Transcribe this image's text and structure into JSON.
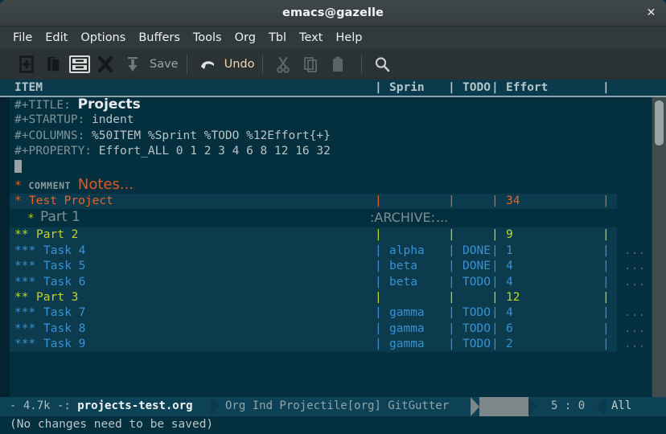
{
  "window": {
    "title": "emacs@gazelle",
    "close_label": "✕"
  },
  "menubar": {
    "items": [
      {
        "label": "File"
      },
      {
        "label": "Edit"
      },
      {
        "label": "Options"
      },
      {
        "label": "Buffers"
      },
      {
        "label": "Tools"
      },
      {
        "label": "Org"
      },
      {
        "label": "Tbl"
      },
      {
        "label": "Text"
      },
      {
        "label": "Help"
      }
    ]
  },
  "toolbar": {
    "items": [
      {
        "name": "new-file-icon",
        "label": ""
      },
      {
        "name": "open-file-icon",
        "label": ""
      },
      {
        "name": "dired-icon",
        "label": ""
      },
      {
        "name": "close-buffer-icon",
        "label": ""
      },
      {
        "name": "save-icon",
        "label": "Save"
      },
      {
        "name": "undo-icon",
        "label": "Undo"
      },
      {
        "name": "cut-icon",
        "label": ""
      },
      {
        "name": "copy-icon",
        "label": ""
      },
      {
        "name": "paste-icon",
        "label": ""
      },
      {
        "name": "search-icon",
        "label": ""
      }
    ],
    "save_label": "Save",
    "undo_label": "Undo"
  },
  "columns_header": {
    "item": "ITEM",
    "sprint": "Sprin",
    "todo": "TODO",
    "effort": "Effort",
    "raw": "ITEM                                               | Sprin | TODO | Effort       |"
  },
  "buffer": {
    "keyword_lines": [
      {
        "key": "#+TITLE:",
        "value": "Projects",
        "big": true
      },
      {
        "key": "#+STARTUP:",
        "value": "indent",
        "big": false
      },
      {
        "key": "#+COLUMNS:",
        "value": "%50ITEM %Sprint %TODO %12Effort{+}",
        "big": false
      },
      {
        "key": "#+PROPERTY:",
        "value": "Effort_ALL 0 1 2 3 4 6 8 12 16 32",
        "big": false
      }
    ],
    "comment_heading": {
      "stars": "*",
      "tag": "COMMENT",
      "title": "Notes",
      "ellipsis": "..."
    },
    "rows": [
      {
        "kind": "column-row",
        "level": 1,
        "stars": "*",
        "title": "Test Project",
        "sprint": "",
        "todo": "",
        "effort": "34",
        "ellipsis": ""
      },
      {
        "kind": "plain",
        "level": 2,
        "stars": "*",
        "title": "Part 1",
        "tag": ":ARCHIVE:",
        "ellipsis": "..."
      },
      {
        "kind": "column-row",
        "level": 2,
        "stars": "**",
        "title": "Part 2",
        "sprint": "",
        "todo": "",
        "effort": "9",
        "ellipsis": ""
      },
      {
        "kind": "column-row",
        "level": 3,
        "stars": "***",
        "title": "Task 4",
        "sprint": "alpha",
        "todo": "DONE",
        "effort": "1",
        "ellipsis": "..."
      },
      {
        "kind": "column-row",
        "level": 3,
        "stars": "***",
        "title": "Task 5",
        "sprint": "beta",
        "todo": "DONE",
        "effort": "4",
        "ellipsis": "..."
      },
      {
        "kind": "column-row",
        "level": 3,
        "stars": "***",
        "title": "Task 6",
        "sprint": "beta",
        "todo": "TODO",
        "effort": "4",
        "ellipsis": "..."
      },
      {
        "kind": "column-row",
        "level": 2,
        "stars": "**",
        "title": "Part 3",
        "sprint": "",
        "todo": "",
        "effort": "12",
        "ellipsis": ""
      },
      {
        "kind": "column-row",
        "level": 3,
        "stars": "***",
        "title": "Task 7",
        "sprint": "gamma",
        "todo": "TODO",
        "effort": "4",
        "ellipsis": "..."
      },
      {
        "kind": "column-row",
        "level": 3,
        "stars": "***",
        "title": "Task 8",
        "sprint": "gamma",
        "todo": "TODO",
        "effort": "6",
        "ellipsis": "..."
      },
      {
        "kind": "column-row",
        "level": 3,
        "stars": "***",
        "title": "Task 9",
        "sprint": "gamma",
        "todo": "TODO",
        "effort": "2",
        "ellipsis": "..."
      }
    ],
    "separators": {
      "pipe": "|"
    }
  },
  "modeline": {
    "size": "- 4.7k -:",
    "buffer_name": "projects-test.org",
    "major_mode": "Org",
    "minor_modes": "Ind Projectile[org] GitGutter",
    "modes_text": "Org Ind Projectile[org] GitGutter",
    "position": "5 : 0",
    "scroll": "All"
  },
  "echo_area": {
    "message": "(No changes need to be saved)"
  },
  "colors": {
    "frame_bg": "#042f3e",
    "column_row_bg": "#0b3b4c",
    "header_bg": "#0a3a4b",
    "modeline_bg": "#0d4155",
    "level1": "#e8622a",
    "level2": "#c3d42a",
    "level3": "#3a91d4",
    "titlebar": "#3b4244",
    "menubar": "#30393b",
    "toolbar": "#2b3234",
    "powerline_gray": "#7d8688"
  }
}
